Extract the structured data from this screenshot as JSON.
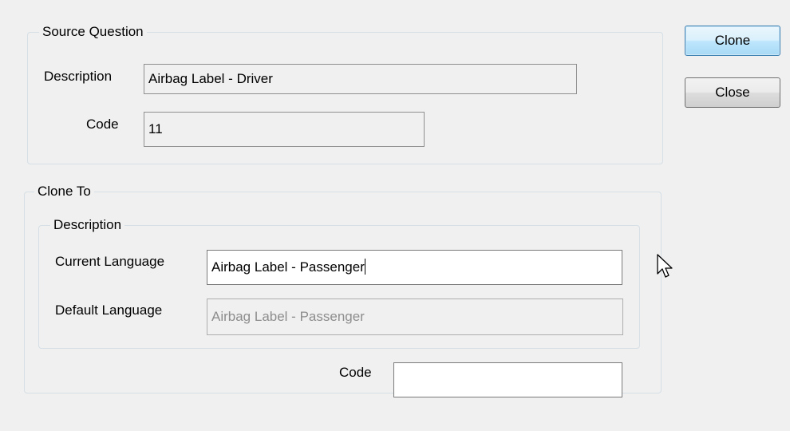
{
  "source_question": {
    "legend": "Source Question",
    "description_label": "Description",
    "description_value": "Airbag Label - Driver",
    "code_label": "Code",
    "code_value": "11"
  },
  "clone_to": {
    "legend": "Clone To",
    "description_group": {
      "legend": "Description",
      "current_language_label": "Current Language",
      "current_language_value": "Airbag Label - Passenger",
      "default_language_label": "Default Language",
      "default_language_value": "Airbag Label - Passenger"
    },
    "code_label": "Code",
    "code_value": ""
  },
  "buttons": {
    "clone_label": "Clone",
    "close_label": "Close"
  },
  "icons": {
    "cursor": "mouse-pointer-icon"
  }
}
